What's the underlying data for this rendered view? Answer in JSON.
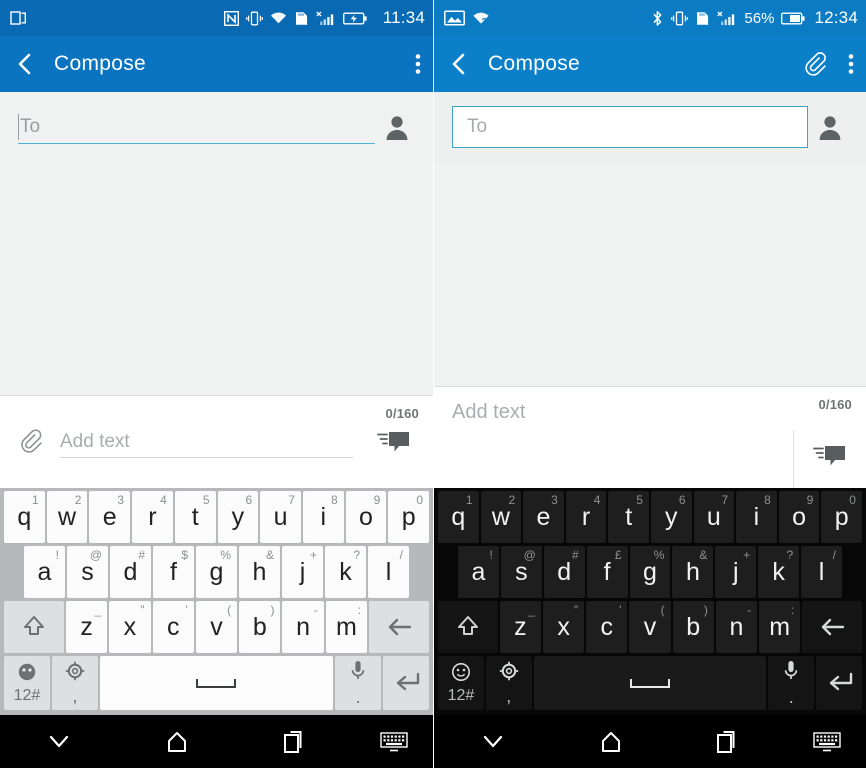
{
  "panels": [
    {
      "id": "left",
      "statusbar": {
        "left_icons": [
          "dual-window-icon"
        ],
        "right_icons": [
          "nfc-icon",
          "vibrate-icon",
          "wifi-icon",
          "sd-card-alert-icon",
          "signal-no-service-icon",
          "battery-charging-icon"
        ],
        "time": "11:34",
        "battery_pct": ""
      },
      "appbar": {
        "back_icon": "back-chevron-icon",
        "title": "Compose",
        "actions": [
          "overflow-menu-icon"
        ]
      },
      "recipient": {
        "placeholder": "To",
        "value": "",
        "style": "underline",
        "contact_icon": "contact-person-icon"
      },
      "compose": {
        "attach_icon": "paperclip-icon",
        "placeholder": "Add text",
        "value": "",
        "counter": "0/160",
        "send_icon": "send-message-icon",
        "layout": "inline"
      },
      "keyboard": {
        "theme": "light",
        "rows": [
          [
            {
              "main": "q",
              "hint": "1"
            },
            {
              "main": "w",
              "hint": "2"
            },
            {
              "main": "e",
              "hint": "3"
            },
            {
              "main": "r",
              "hint": "4"
            },
            {
              "main": "t",
              "hint": "5"
            },
            {
              "main": "y",
              "hint": "6"
            },
            {
              "main": "u",
              "hint": "7"
            },
            {
              "main": "i",
              "hint": "8"
            },
            {
              "main": "o",
              "hint": "9"
            },
            {
              "main": "p",
              "hint": "0"
            }
          ],
          [
            {
              "main": "a",
              "hint": "!"
            },
            {
              "main": "s",
              "hint": "@"
            },
            {
              "main": "d",
              "hint": "#"
            },
            {
              "main": "f",
              "hint": "$"
            },
            {
              "main": "g",
              "hint": "%"
            },
            {
              "main": "h",
              "hint": "&"
            },
            {
              "main": "j",
              "hint": "+"
            },
            {
              "main": "k",
              "hint": "?"
            },
            {
              "main": "l",
              "hint": "/"
            }
          ],
          [
            {
              "main": "z",
              "hint": "_"
            },
            {
              "main": "x",
              "hint": "\""
            },
            {
              "main": "c",
              "hint": "'"
            },
            {
              "main": "v",
              "hint": "("
            },
            {
              "main": "b",
              "hint": ")"
            },
            {
              "main": "n",
              "hint": "-"
            },
            {
              "main": "m",
              "hint": ":"
            }
          ]
        ],
        "shift_icon": "shift-arrow-icon",
        "backspace_icon": "backspace-icon",
        "symbols_label": "12#",
        "emoji_icon": "emoji-face-icon",
        "settings_icon": "settings-gear-icon",
        "comma_label": ",",
        "mic_icon": "microphone-icon",
        "period_label": ".",
        "enter_icon": "enter-return-icon"
      },
      "navbar": {
        "buttons": [
          "hide-keyboard-chevron-icon",
          "home-icon",
          "recents-icon",
          "keyboard-switch-icon"
        ]
      }
    },
    {
      "id": "right",
      "statusbar": {
        "left_icons": [
          "screenshot-icon",
          "wifi-question-icon"
        ],
        "right_icons": [
          "bluetooth-icon",
          "vibrate-icon",
          "sd-card-alert-icon",
          "signal-no-service-icon"
        ],
        "time": "12:34",
        "battery_pct": "56%"
      },
      "appbar": {
        "back_icon": "back-chevron-icon",
        "title": "Compose",
        "actions": [
          "paperclip-icon",
          "overflow-menu-icon"
        ]
      },
      "recipient": {
        "placeholder": "To",
        "value": "",
        "style": "box",
        "contact_icon": "contact-person-icon"
      },
      "compose": {
        "attach_icon": "",
        "placeholder": "Add text",
        "value": "",
        "counter": "0/160",
        "send_icon": "send-message-icon",
        "layout": "stacked"
      },
      "keyboard": {
        "theme": "dark",
        "rows": [
          [
            {
              "main": "q",
              "hint": "1"
            },
            {
              "main": "w",
              "hint": "2"
            },
            {
              "main": "e",
              "hint": "3"
            },
            {
              "main": "r",
              "hint": "4"
            },
            {
              "main": "t",
              "hint": "5"
            },
            {
              "main": "y",
              "hint": "6"
            },
            {
              "main": "u",
              "hint": "7"
            },
            {
              "main": "i",
              "hint": "8"
            },
            {
              "main": "o",
              "hint": "9"
            },
            {
              "main": "p",
              "hint": "0"
            }
          ],
          [
            {
              "main": "a",
              "hint": "!"
            },
            {
              "main": "s",
              "hint": "@"
            },
            {
              "main": "d",
              "hint": "#"
            },
            {
              "main": "f",
              "hint": "£"
            },
            {
              "main": "g",
              "hint": "%"
            },
            {
              "main": "h",
              "hint": "&"
            },
            {
              "main": "j",
              "hint": "+"
            },
            {
              "main": "k",
              "hint": "?"
            },
            {
              "main": "l",
              "hint": "/"
            }
          ],
          [
            {
              "main": "z",
              "hint": "_"
            },
            {
              "main": "x",
              "hint": "\""
            },
            {
              "main": "c",
              "hint": "'"
            },
            {
              "main": "v",
              "hint": "("
            },
            {
              "main": "b",
              "hint": ")"
            },
            {
              "main": "n",
              "hint": "-"
            },
            {
              "main": "m",
              "hint": ":"
            }
          ]
        ],
        "shift_icon": "shift-arrow-icon",
        "backspace_icon": "backspace-icon",
        "symbols_label": "12#",
        "emoji_icon": "emoji-face-icon",
        "settings_icon": "settings-gear-icon",
        "comma_label": ",",
        "mic_icon": "microphone-icon",
        "period_label": ".",
        "enter_icon": "enter-return-icon"
      },
      "navbar": {
        "buttons": [
          "hide-keyboard-chevron-icon",
          "home-icon",
          "recents-icon",
          "keyboard-switch-icon"
        ]
      }
    }
  ],
  "colors": {
    "statusbar_left": "#0a69b3",
    "statusbar_right": "#0b7cc4",
    "appbar_left": "#0b74c0",
    "appbar_right": "#0b7fc8",
    "body": "#f0f1f1",
    "accent_underline": "#4fb3d9",
    "keyboard_light_bg": "#b6b9ba",
    "keyboard_dark_bg": "#070707",
    "navbar": "#000000"
  }
}
